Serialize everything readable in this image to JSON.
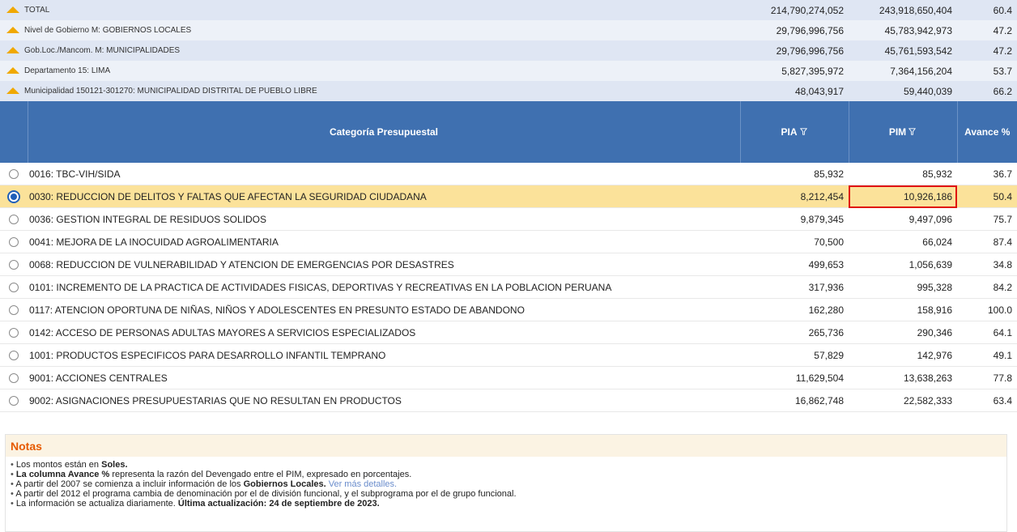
{
  "hierarchy": [
    {
      "label": "TOTAL",
      "pia": "214,790,274,052",
      "pim": "243,918,650,404",
      "avance": "60.4"
    },
    {
      "label": "Nivel de Gobierno M: GOBIERNOS LOCALES",
      "pia": "29,796,996,756",
      "pim": "45,783,942,973",
      "avance": "47.2"
    },
    {
      "label": "Gob.Loc./Mancom. M: MUNICIPALIDADES",
      "pia": "29,796,996,756",
      "pim": "45,761,593,542",
      "avance": "47.2"
    },
    {
      "label": "Departamento 15: LIMA",
      "pia": "5,827,395,972",
      "pim": "7,364,156,204",
      "avance": "53.7"
    },
    {
      "label": "Municipalidad 150121-301270: MUNICIPALIDAD DISTRITAL DE PUEBLO LIBRE",
      "pia": "48,043,917",
      "pim": "59,440,039",
      "avance": "66.2"
    }
  ],
  "header": {
    "category": "Categoría Presupuestal",
    "pia": "PIA",
    "pim": "PIM",
    "avance": "Avance %"
  },
  "rows": [
    {
      "label": "0016: TBC-VIH/SIDA",
      "pia": "85,932",
      "pim": "85,932",
      "avance": "36.7"
    },
    {
      "label": "0030: REDUCCION DE DELITOS Y FALTAS QUE AFECTAN LA SEGURIDAD CIUDADANA",
      "pia": "8,212,454",
      "pim": "10,926,186",
      "avance": "50.4"
    },
    {
      "label": "0036: GESTION INTEGRAL DE RESIDUOS SOLIDOS",
      "pia": "9,879,345",
      "pim": "9,497,096",
      "avance": "75.7"
    },
    {
      "label": "0041: MEJORA DE LA INOCUIDAD AGROALIMENTARIA",
      "pia": "70,500",
      "pim": "66,024",
      "avance": "87.4"
    },
    {
      "label": "0068: REDUCCION DE VULNERABILIDAD Y ATENCION DE EMERGENCIAS POR DESASTRES",
      "pia": "499,653",
      "pim": "1,056,639",
      "avance": "34.8"
    },
    {
      "label": "0101: INCREMENTO DE LA PRACTICA DE ACTIVIDADES FISICAS, DEPORTIVAS Y RECREATIVAS EN LA POBLACION PERUANA",
      "pia": "317,936",
      "pim": "995,328",
      "avance": "84.2"
    },
    {
      "label": "0117: ATENCION OPORTUNA DE NIÑAS, NIÑOS Y ADOLESCENTES EN PRESUNTO ESTADO DE ABANDONO",
      "pia": "162,280",
      "pim": "158,916",
      "avance": "100.0"
    },
    {
      "label": "0142: ACCESO DE PERSONAS ADULTAS MAYORES A SERVICIOS ESPECIALIZADOS",
      "pia": "265,736",
      "pim": "290,346",
      "avance": "64.1"
    },
    {
      "label": "1001: PRODUCTOS ESPECIFICOS PARA DESARROLLO INFANTIL TEMPRANO",
      "pia": "57,829",
      "pim": "142,976",
      "avance": "49.1"
    },
    {
      "label": "9001: ACCIONES CENTRALES",
      "pia": "11,629,504",
      "pim": "13,638,263",
      "avance": "77.8"
    },
    {
      "label": "9002: ASIGNACIONES PRESUPUESTARIAS QUE NO RESULTAN EN PRODUCTOS",
      "pia": "16,862,748",
      "pim": "22,582,333",
      "avance": "63.4"
    }
  ],
  "notes": {
    "title": "Notas",
    "n1_a": "Los montos están en ",
    "n1_b": "Soles.",
    "n2_a": "La columna Avance %",
    "n2_b": " representa la razón del Devengado entre el PIM, expresado en porcentajes.",
    "n3_a": "A partir del 2007 se comienza a incluir información de los ",
    "n3_b": "Gobiernos Locales.",
    "n3_link": "Ver más detalles.",
    "n4": "A partir del 2012 el programa cambia de denominación por el de división funcional, y el subprograma por el de grupo funcional.",
    "n5_a": "La información se actualiza diariamente. ",
    "n5_b": "Última actualización: 24 de septiembre de 2023."
  },
  "colors": {
    "header": "#3f70b0",
    "selected_row": "#fbe29a",
    "highlight_border": "#e01010",
    "notes_title": "#e65a00"
  }
}
